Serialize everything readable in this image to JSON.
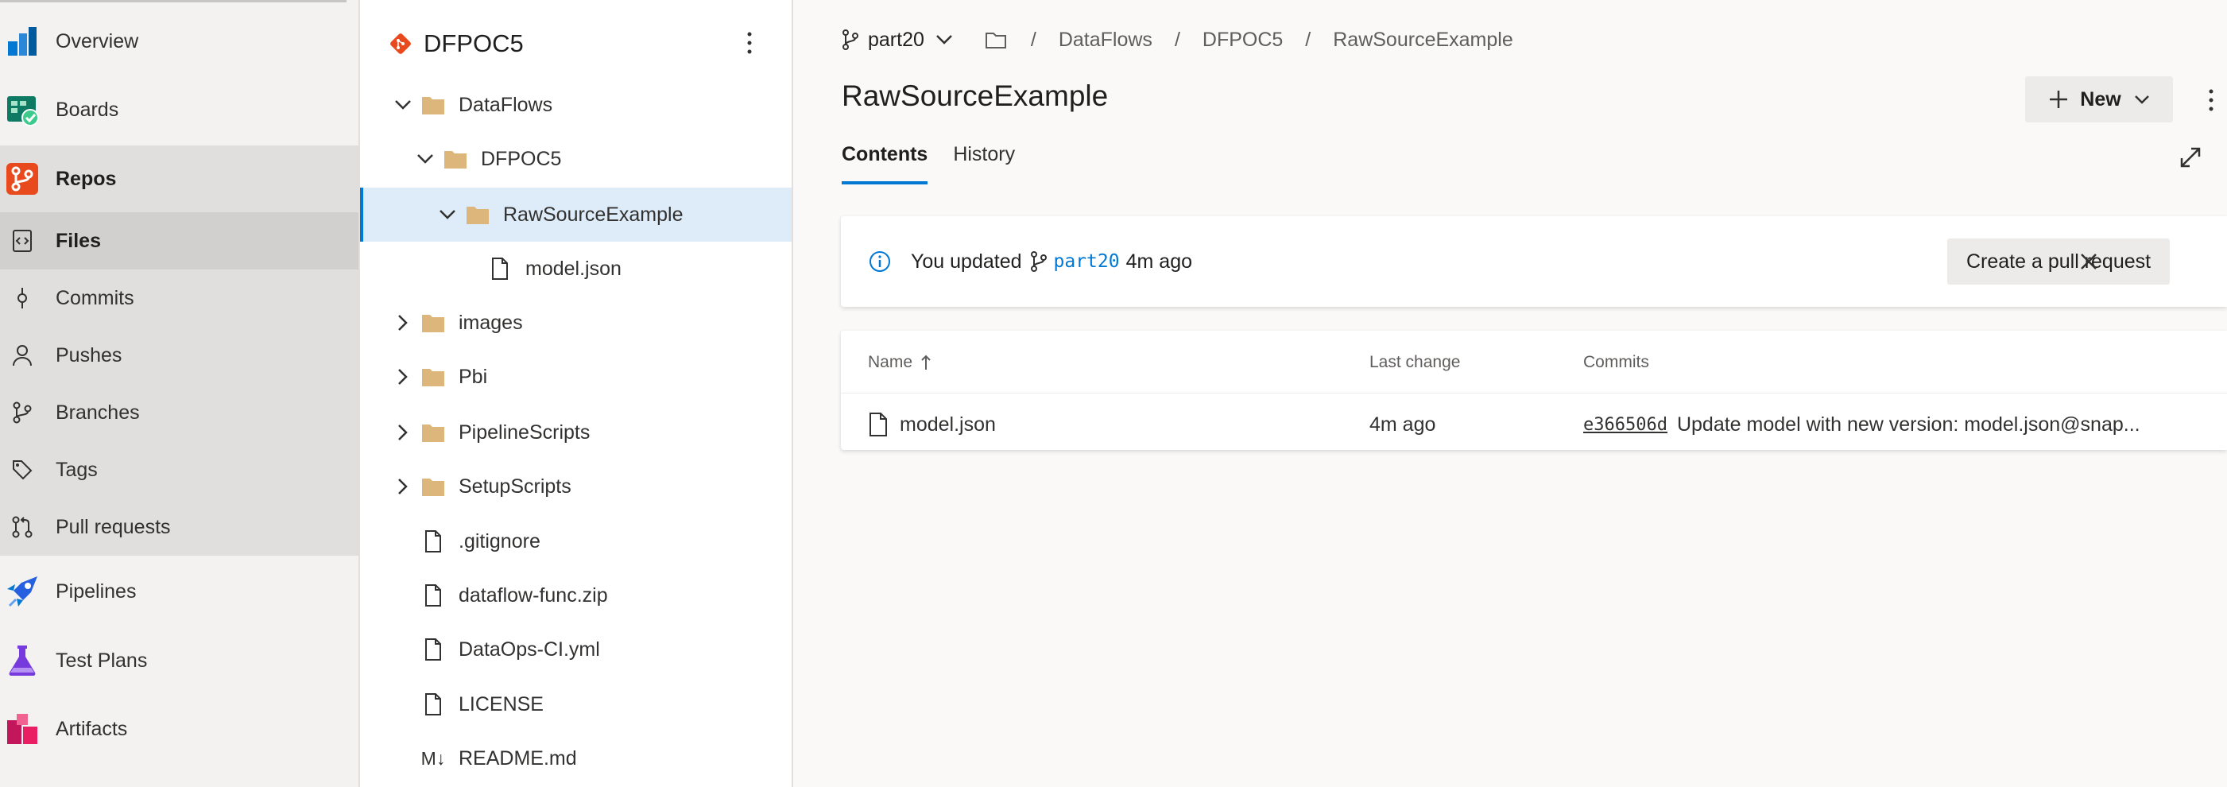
{
  "nav": {
    "overview": "Overview",
    "boards": "Boards",
    "repos": "Repos",
    "files": "Files",
    "commits": "Commits",
    "pushes": "Pushes",
    "branches": "Branches",
    "tags": "Tags",
    "pull_requests": "Pull requests",
    "pipelines": "Pipelines",
    "test_plans": "Test Plans",
    "artifacts": "Artifacts"
  },
  "tree": {
    "repo_name": "DFPOC5",
    "items": [
      {
        "name": "DataFlows",
        "type": "folder",
        "expanded": true
      },
      {
        "name": "DFPOC5",
        "type": "folder",
        "expanded": true
      },
      {
        "name": "RawSourceExample",
        "type": "folder",
        "expanded": true,
        "selected": true
      },
      {
        "name": "model.json",
        "type": "file"
      },
      {
        "name": "images",
        "type": "folder",
        "expanded": false
      },
      {
        "name": "Pbi",
        "type": "folder",
        "expanded": false
      },
      {
        "name": "PipelineScripts",
        "type": "folder",
        "expanded": false
      },
      {
        "name": "SetupScripts",
        "type": "folder",
        "expanded": false
      },
      {
        "name": ".gitignore",
        "type": "file"
      },
      {
        "name": "dataflow-func.zip",
        "type": "file"
      },
      {
        "name": "DataOps-CI.yml",
        "type": "file"
      },
      {
        "name": "LICENSE",
        "type": "file"
      },
      {
        "name": "README.md",
        "type": "markdown",
        "icon_text": "M↓"
      }
    ]
  },
  "header": {
    "branch": "part20",
    "breadcrumbs": [
      "DataFlows",
      "DFPOC5",
      "RawSourceExample"
    ],
    "title": "RawSourceExample",
    "new_label": "New"
  },
  "tabs": [
    "Contents",
    "History"
  ],
  "notice": {
    "prefix": "You updated",
    "branch": "part20",
    "suffix": "4m ago",
    "pr_button": "Create a pull request"
  },
  "table": {
    "headers": {
      "name": "Name",
      "last_change": "Last change",
      "commits": "Commits"
    },
    "rows": [
      {
        "name": "model.json",
        "last_change": "4m ago",
        "commit_id": "e366506d",
        "commit_msg": "Update model with new version: model.json@snap..."
      }
    ]
  },
  "colors": {
    "accent": "#0078d4",
    "folder": "#dcb67a",
    "selected_row": "#deecf9"
  }
}
